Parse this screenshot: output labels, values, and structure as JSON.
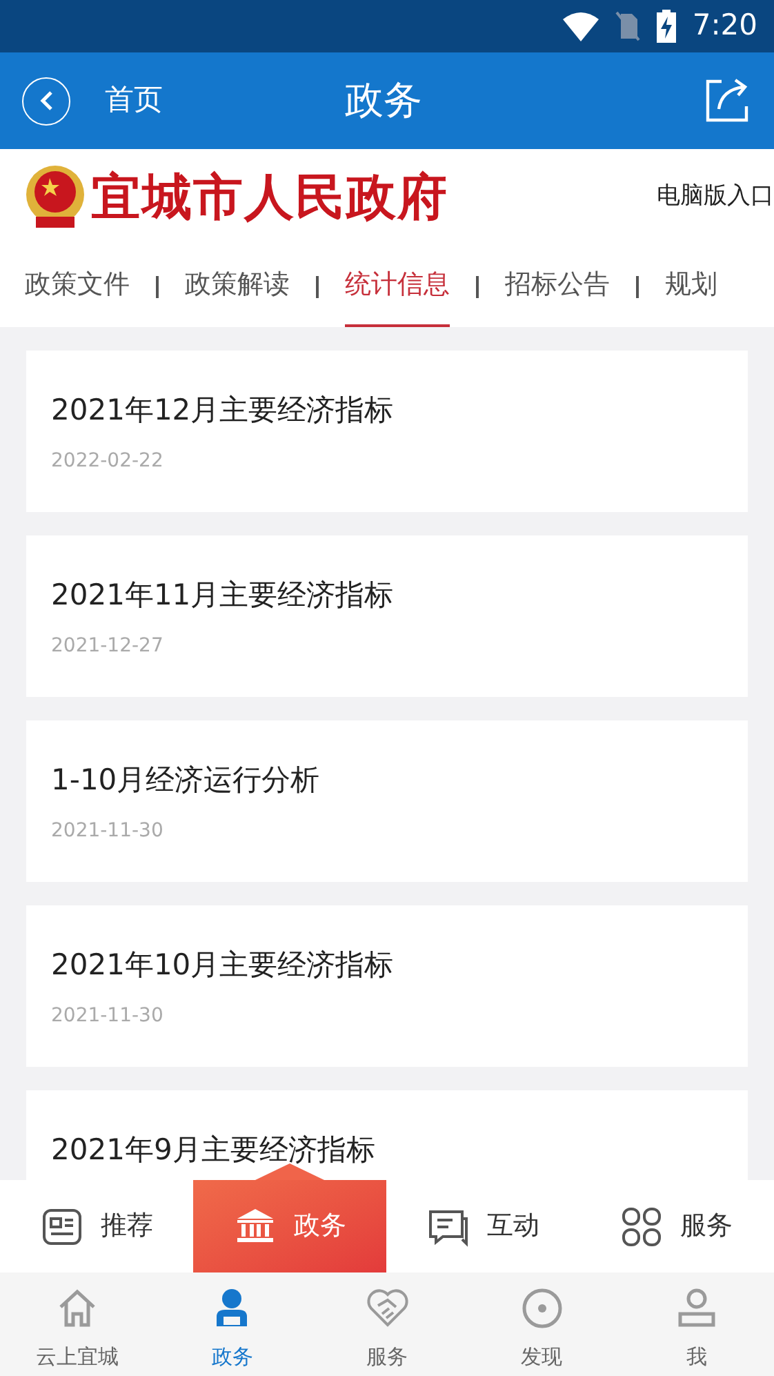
{
  "status_bar": {
    "time": "7:20"
  },
  "header": {
    "back_label": "首页",
    "title": "政务"
  },
  "site": {
    "name": "宜城市人民政府",
    "desktop_link": "电脑版入口"
  },
  "tabs": [
    {
      "label": "政策文件",
      "selected": false
    },
    {
      "label": "政策解读",
      "selected": false
    },
    {
      "label": "统计信息",
      "selected": true
    },
    {
      "label": "招标公告",
      "selected": false
    },
    {
      "label": "规划",
      "selected": false
    }
  ],
  "articles": [
    {
      "title": "2021年12月主要经济指标",
      "date": "2022-02-22"
    },
    {
      "title": "2021年11月主要经济指标",
      "date": "2021-12-27"
    },
    {
      "title": "1-10月经济运行分析",
      "date": "2021-11-30"
    },
    {
      "title": "2021年10月主要经济指标",
      "date": "2021-11-30"
    },
    {
      "title": "2021年9月主要经济指标"
    }
  ],
  "float_menu": [
    {
      "kind": "news",
      "label": "推荐",
      "selected": false
    },
    {
      "kind": "gov",
      "label": "政务",
      "selected": true
    },
    {
      "kind": "chat",
      "label": "互动",
      "selected": false
    },
    {
      "kind": "grid",
      "label": "服务",
      "selected": false
    }
  ],
  "bottom_nav": [
    {
      "kind": "home",
      "label": "云上宜城",
      "selected": false
    },
    {
      "kind": "person",
      "label": "政务",
      "selected": true
    },
    {
      "kind": "handshake",
      "label": "服务",
      "selected": false
    },
    {
      "kind": "discover",
      "label": "发现",
      "selected": false
    },
    {
      "kind": "me",
      "label": "我",
      "selected": false
    }
  ]
}
